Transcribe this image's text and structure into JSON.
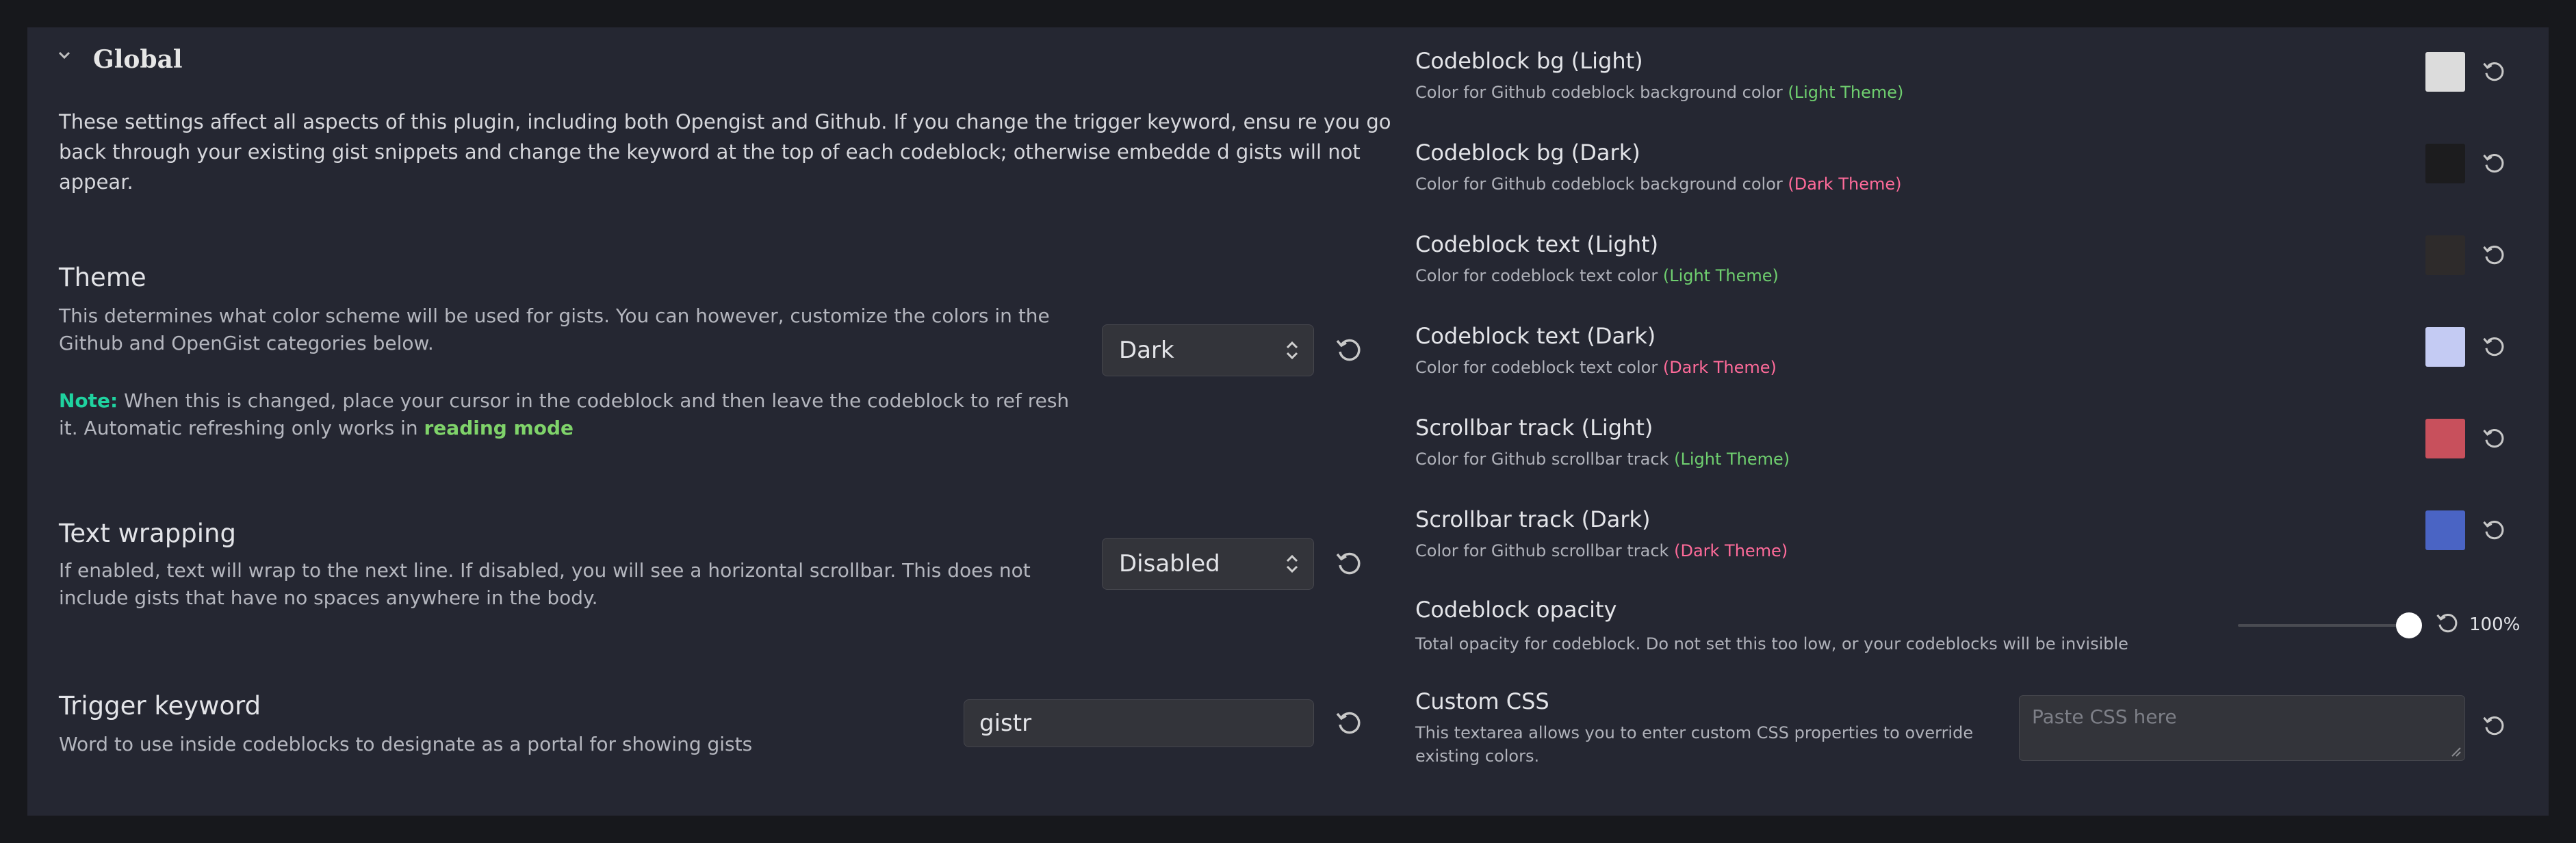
{
  "section": {
    "title": "Global",
    "description": "These settings affect all aspects of this plugin, including both Opengist and Github. If you change the trigger keyword, ensu re you go back through your existing gist snippets and change the keyword at the top of each codeblock; otherwise embedde d gists will not appear."
  },
  "theme": {
    "name": "Theme",
    "description": "This determines what color scheme will be used for gists. You can however, customize the colors in the Github and OpenGist categories below.",
    "note_label": "Note:",
    "note_text": " When this is changed, place your cursor in the codeblock and then leave the codeblock to ref resh it. Automatic refreshing only works in ",
    "note_emphasis": "reading mode",
    "value": "Dark"
  },
  "text_wrapping": {
    "name": "Text wrapping",
    "description": "If enabled, text will wrap to the next line. If disabled, you will see a horizontal scrollbar. This does not include gists that have no spaces anywhere in the body.",
    "value": "Disabled"
  },
  "trigger_keyword": {
    "name": "Trigger keyword",
    "description": "Word to use inside codeblocks to designate as a portal for showing gists",
    "value": "gistr"
  },
  "colors": [
    {
      "name": "Codeblock bg (Light)",
      "desc": "Color for Github codeblock background color ",
      "tag": "(Light Theme)",
      "tag_color": "green",
      "swatch": "#dcdcdc"
    },
    {
      "name": "Codeblock bg (Dark)",
      "desc": "Color for Github codeblock background color ",
      "tag": "(Dark Theme)",
      "tag_color": "pink",
      "swatch": "#1c1c1e"
    },
    {
      "name": "Codeblock text (Light)",
      "desc": "Color for codeblock text color ",
      "tag": "(Light Theme)",
      "tag_color": "green",
      "swatch": "#2e2b2b"
    },
    {
      "name": "Codeblock text (Dark)",
      "desc": "Color for codeblock text color ",
      "tag": "(Dark Theme)",
      "tag_color": "pink",
      "swatch": "#c4cbf3"
    },
    {
      "name": "Scrollbar track (Light)",
      "desc": "Color for Github scrollbar track ",
      "tag": "(Light Theme)",
      "tag_color": "green",
      "swatch": "#c8505c"
    },
    {
      "name": "Scrollbar track (Dark)",
      "desc": "Color for Github scrollbar track ",
      "tag": "(Dark Theme)",
      "tag_color": "pink",
      "swatch": "#4a64c4"
    }
  ],
  "opacity": {
    "name": "Codeblock opacity",
    "description": "Total opacity for codeblock. Do not set this too low, or your codeblocks will be invisible",
    "value_label": "100%",
    "value": 1.0
  },
  "custom_css": {
    "name": "Custom CSS",
    "description": "This textarea allows you to enter custom CSS properties to override existing colors.",
    "placeholder": "Paste CSS here"
  },
  "icons": {
    "collapse": "chevron-down-icon",
    "reset": "reset-icon",
    "select": "updown-arrows-icon"
  }
}
